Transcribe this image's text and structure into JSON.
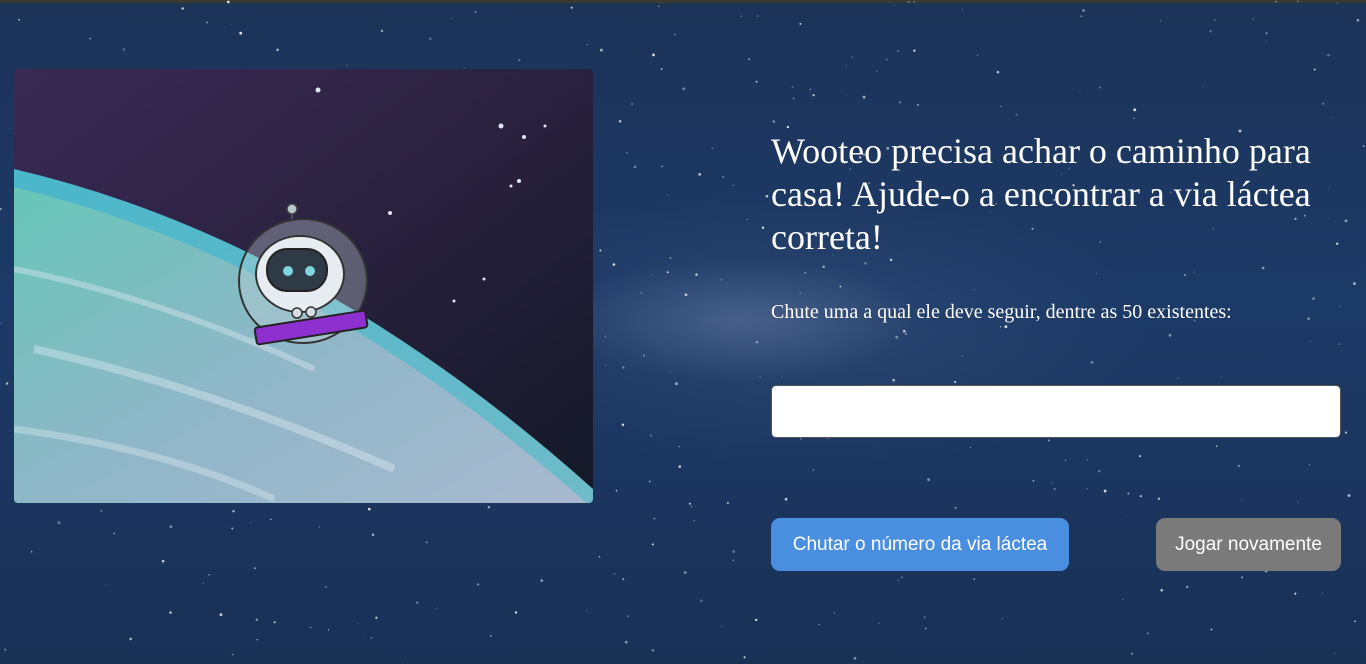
{
  "game": {
    "heading": "Wooteo precisa achar o caminho para casa! Ajude-o a encontrar a via láctea correta!",
    "instruction": "Chute uma a qual ele deve seguir, dentre as 50 existentes:",
    "guess_input": {
      "value": "",
      "placeholder": ""
    },
    "guess_button_label": "Chutar o número da via láctea",
    "replay_button_label": "Jogar novamente"
  },
  "colors": {
    "background": "#1c3a67",
    "guess_button": "#4a8ee0",
    "replay_button": "#7a7a7a",
    "text": "#ffffff"
  },
  "hero_image": {
    "icon": "astronaut-robot-in-space-illustration"
  }
}
